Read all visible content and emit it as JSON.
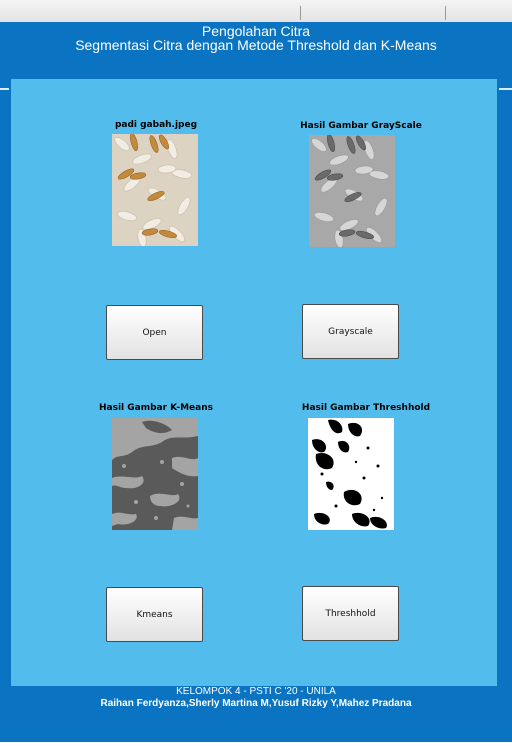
{
  "header": {
    "line1": "Pengolahan Citra",
    "line2": "Segmentasi Citra dengan Metode Threshold dan K-Means"
  },
  "images": {
    "original_caption": "padi gabah.jpeg",
    "grayscale_caption": "Hasil Gambar GrayScale",
    "kmeans_caption": "Hasil Gambar K-Means",
    "threshold_caption": "Hasil Gambar Threshhold"
  },
  "buttons": {
    "open_label": "Open",
    "grayscale_label": "Grayscale",
    "kmeans_label": "Kmeans",
    "threshold_label": "Threshhold"
  },
  "footer": {
    "line1": "KELOMPOK 4 - PSTI C '20 - UNILA",
    "line2": "Raihan Ferdyanza,Sherly Martina M,Yusuf Rizky Y,Mahez Pradana"
  },
  "colors": {
    "background": "#0a73c2",
    "panel": "#52bdec",
    "text": "#ffffff"
  }
}
